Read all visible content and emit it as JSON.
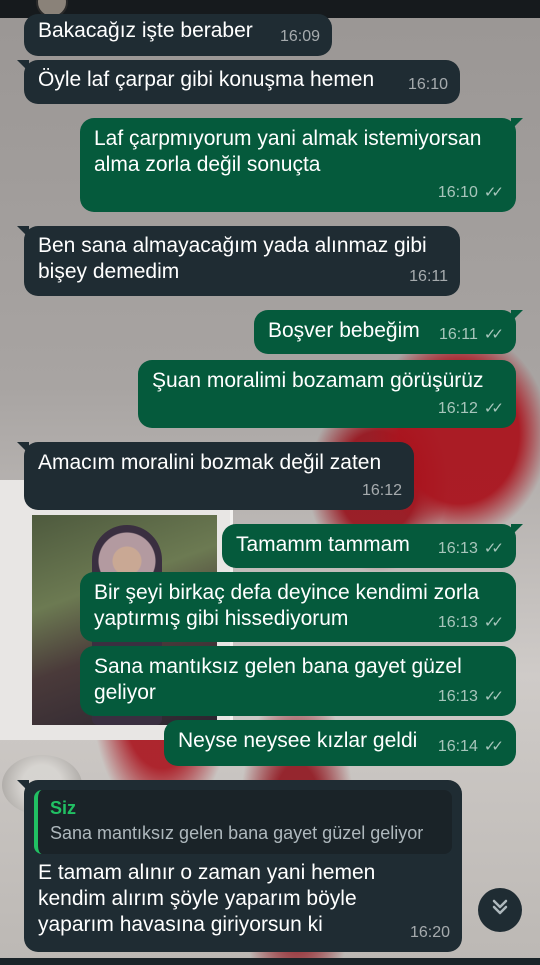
{
  "messages": [
    {
      "id": "m1",
      "dir": "in",
      "text": "Bakacağız işte beraber",
      "time": "16:09"
    },
    {
      "id": "m2",
      "dir": "in",
      "text": "Öyle laf çarpar gibi konuşma hemen",
      "time": "16:10"
    },
    {
      "id": "m3",
      "dir": "out",
      "text": "Laf çarpmıyorum yani almak istemiyorsan alma zorla değil sonuçta",
      "time": "16:10"
    },
    {
      "id": "m4",
      "dir": "in",
      "text": "Ben sana almayacağım yada alınmaz gibi bişey demedim",
      "time": "16:11"
    },
    {
      "id": "m5",
      "dir": "out",
      "text": "Boşver bebeğim",
      "time": "16:11"
    },
    {
      "id": "m6",
      "dir": "out",
      "text": "Şuan moralimi bozamam görüşürüz",
      "time": "16:12"
    },
    {
      "id": "m7",
      "dir": "in",
      "text": "Amacım moralini bozmak değil zaten",
      "time": "16:12"
    },
    {
      "id": "m8",
      "dir": "out",
      "text": "Tamamm tammam",
      "time": "16:13"
    },
    {
      "id": "m9",
      "dir": "out",
      "text": "Bir şeyi birkaç defa deyince kendimi zorla yaptırmış gibi hissediyorum",
      "time": "16:13"
    },
    {
      "id": "m10",
      "dir": "out",
      "text": "Sana mantıksız gelen bana gayet güzel geliyor",
      "time": "16:13"
    },
    {
      "id": "m11",
      "dir": "out",
      "text": "Neyse neysee kızlar geldi",
      "time": "16:14"
    },
    {
      "id": "m12",
      "dir": "in",
      "text": "E tamam alınır o zaman yani hemen kendim alırım şöyle yaparım böyle yaparım havasına giriyorsun ki",
      "time": "16:20",
      "reply": {
        "author": "Siz",
        "text": "Sana mantıksız gelen bana gayet güzel geliyor"
      }
    }
  ],
  "read_ticks": "✓✓",
  "scroll_down_icon": "double-chevron-down-icon",
  "colors": {
    "incoming": "#1f2c33",
    "outgoing": "#055a3c",
    "reply_accent": "#21c063"
  }
}
